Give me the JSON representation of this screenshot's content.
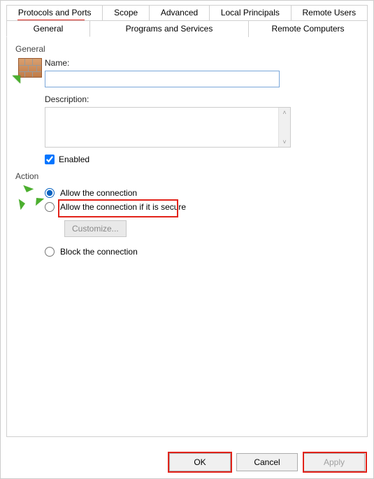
{
  "tabs": {
    "row1": [
      {
        "label": "Protocols and Ports"
      },
      {
        "label": "Scope"
      },
      {
        "label": "Advanced"
      },
      {
        "label": "Local Principals"
      },
      {
        "label": "Remote Users"
      }
    ],
    "row2": [
      {
        "label": "General",
        "active": true
      },
      {
        "label": "Programs and Services"
      },
      {
        "label": "Remote Computers"
      }
    ]
  },
  "general": {
    "group_label": "General",
    "name_label": "Name:",
    "name_value": "",
    "description_label": "Description:",
    "description_value": "",
    "enabled_label": "Enabled",
    "enabled_checked": true
  },
  "action": {
    "group_label": "Action",
    "options": {
      "allow": "Allow the connection",
      "allow_secure": "Allow the connection if it is secure",
      "block": "Block the connection"
    },
    "selected": "allow",
    "customize_label": "Customize...",
    "customize_enabled": false
  },
  "footer": {
    "ok": "OK",
    "cancel": "Cancel",
    "apply": "Apply",
    "apply_enabled": false
  }
}
